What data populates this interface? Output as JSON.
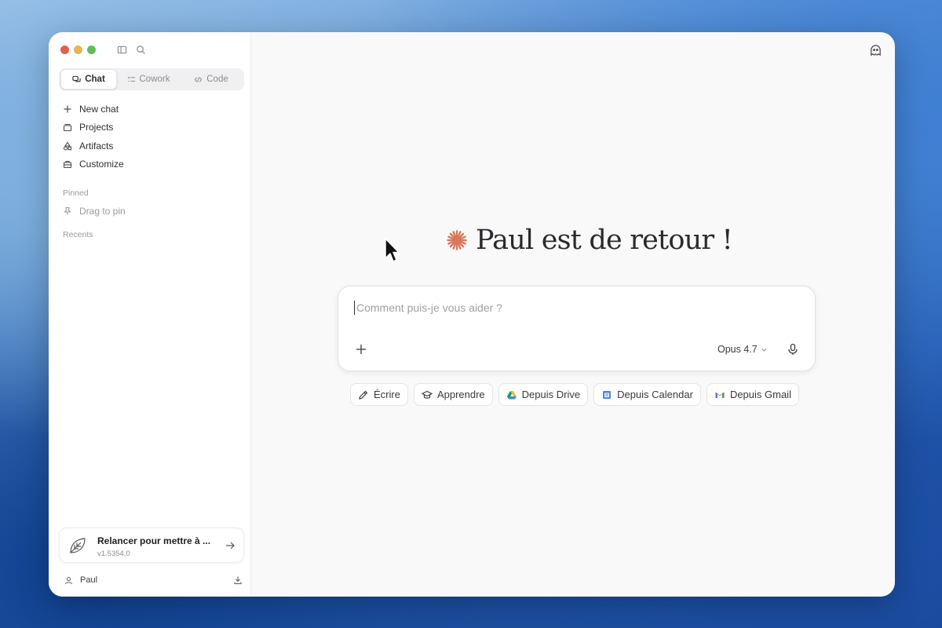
{
  "window": {
    "sidebar": {
      "tabs": [
        {
          "label": "Chat",
          "icon": "chat-bubbles-icon",
          "active": true
        },
        {
          "label": "Cowork",
          "icon": "checklist-icon",
          "active": false
        },
        {
          "label": "Code",
          "icon": "code-brackets-icon",
          "active": false
        }
      ],
      "nav": [
        {
          "label": "New chat",
          "icon": "plus-icon"
        },
        {
          "label": "Projects",
          "icon": "folder-stack-icon"
        },
        {
          "label": "Artifacts",
          "icon": "shapes-icon"
        },
        {
          "label": "Customize",
          "icon": "briefcase-icon"
        }
      ],
      "pinned_label": "Pinned",
      "drag_to_pin": "Drag to pin",
      "recents_label": "Recents",
      "update": {
        "title": "Relancer pour mettre à ...",
        "version": "v1.5354.0"
      },
      "user": {
        "name": "Paul"
      }
    },
    "main": {
      "greeting": "Paul est de retour !",
      "composer": {
        "placeholder": "Comment puis-je vous aider ?",
        "value": "",
        "model": "Opus 4.7"
      },
      "chips": [
        {
          "label": "Écrire",
          "icon": "pencil-icon"
        },
        {
          "label": "Apprendre",
          "icon": "graduation-cap-icon"
        },
        {
          "label": "Depuis Drive",
          "icon": "google-drive-icon"
        },
        {
          "label": "Depuis Calendar",
          "icon": "google-calendar-icon"
        },
        {
          "label": "Depuis Gmail",
          "icon": "gmail-icon"
        }
      ]
    }
  },
  "colors": {
    "accent": "#d9775a",
    "window_bg": "#f9f9fa",
    "sidebar_bg": "#ffffff",
    "traffic_red": "#e0604f",
    "traffic_yellow": "#e2b659",
    "traffic_green": "#61be5b"
  }
}
